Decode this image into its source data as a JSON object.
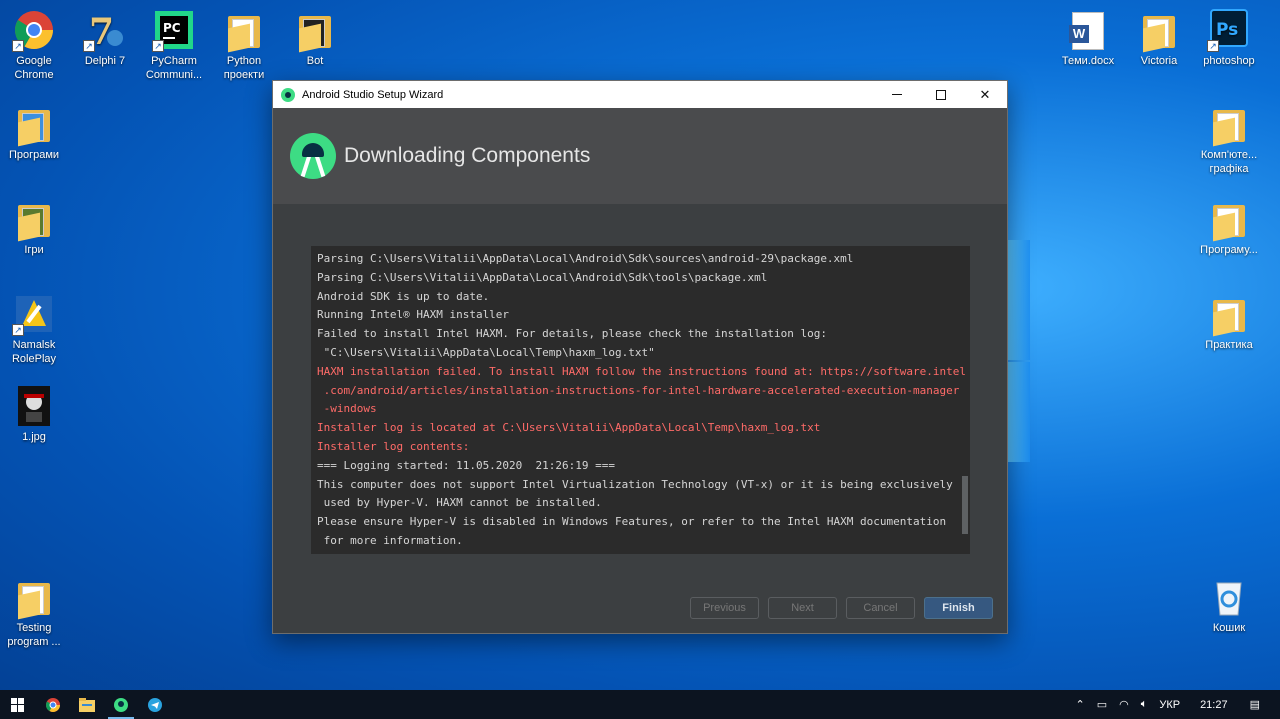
{
  "desktop": {
    "left_icons": [
      {
        "name": "google-chrome-icon",
        "label": "Google Chrome"
      },
      {
        "name": "delphi-7-icon",
        "label": "Delphi 7"
      },
      {
        "name": "pycharm-icon",
        "label": "PyCharm Communi..."
      },
      {
        "name": "python-projects-folder-icon",
        "label": "Python проекти"
      },
      {
        "name": "bot-icon",
        "label": "Bot"
      },
      {
        "name": "programs-folder-icon",
        "label": "Програми"
      },
      {
        "name": "games-folder-icon",
        "label": "Ігри"
      },
      {
        "name": "namalsk-roleplay-icon",
        "label": "Namalsk RolePlay"
      },
      {
        "name": "image-1jpg-icon",
        "label": "1.jpg"
      },
      {
        "name": "testing-program-folder-icon",
        "label": "Testing program ..."
      }
    ],
    "right_icons": [
      {
        "name": "temy-docx-icon",
        "label": "Теми.docx"
      },
      {
        "name": "victoria-folder-icon",
        "label": "Victoria"
      },
      {
        "name": "photoshop-icon",
        "label": "photoshop"
      },
      {
        "name": "computer-graphics-folder-icon",
        "label": "Комп'юте... графіка"
      },
      {
        "name": "programming-folder-icon",
        "label": "Програму..."
      },
      {
        "name": "practice-doc-icon",
        "label": "Практика"
      },
      {
        "name": "recycle-bin-icon",
        "label": "Кошик"
      }
    ]
  },
  "window": {
    "title": "Android Studio Setup Wizard",
    "header_title": "Downloading Components",
    "console_lines": [
      {
        "text": "Parsing C:\\Users\\Vitalii\\AppData\\Local\\Android\\Sdk\\sources\\android-29\\package.xml",
        "error": false
      },
      {
        "text": "Parsing C:\\Users\\Vitalii\\AppData\\Local\\Android\\Sdk\\tools\\package.xml",
        "error": false
      },
      {
        "text": "Android SDK is up to date.",
        "error": false
      },
      {
        "text": "Running Intel® HAXM installer",
        "error": false
      },
      {
        "text": "Failed to install Intel HAXM. For details, please check the installation log:",
        "error": false
      },
      {
        "text": " \"C:\\Users\\Vitalii\\AppData\\Local\\Temp\\haxm_log.txt\"",
        "error": false
      },
      {
        "text": "HAXM installation failed. To install HAXM follow the instructions found at: https://software.intel",
        "error": true
      },
      {
        "text": " .com/android/articles/installation-instructions-for-intel-hardware-accelerated-execution-manager",
        "error": true
      },
      {
        "text": " -windows",
        "error": true
      },
      {
        "text": "Installer log is located at C:\\Users\\Vitalii\\AppData\\Local\\Temp\\haxm_log.txt",
        "error": true
      },
      {
        "text": "Installer log contents:",
        "error": true
      },
      {
        "text": "=== Logging started: 11.05.2020  21:26:19 ===",
        "error": false
      },
      {
        "text": "This computer does not support Intel Virtualization Technology (VT-x) or it is being exclusively",
        "error": false
      },
      {
        "text": " used by Hyper-V. HAXM cannot be installed.",
        "error": false
      },
      {
        "text": "Please ensure Hyper-V is disabled in Windows Features, or refer to the Intel HAXM documentation",
        "error": false
      },
      {
        "text": " for more information.",
        "error": false
      }
    ],
    "buttons": {
      "previous": "Previous",
      "next": "Next",
      "cancel": "Cancel",
      "finish": "Finish"
    }
  },
  "taskbar": {
    "language": "УКР",
    "time": "21:27"
  },
  "colors": {
    "console_error": "#ff6b68",
    "finish_button": "#365880",
    "android_green": "#3ddc84"
  }
}
